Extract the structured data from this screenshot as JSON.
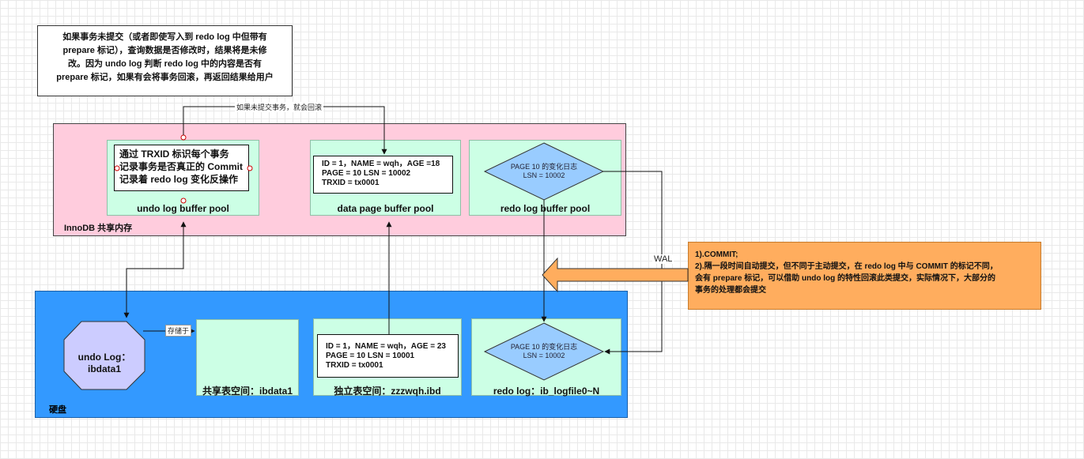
{
  "top_note": "如果事务未提交（或者即使写入到 redo log 中但带有\nprepare 标记），查询数据是否修改时，结果将是未修\n改。因为 undo log 判断 redo log 中的内容是否有\nprepare 标记，如果有会将事务回滚，再返回结果给用户",
  "rollback_edge_label": "如果未提交事务，就会回滚",
  "innodb": {
    "label": "InnoDB 共享内存",
    "undo_pool": {
      "label": "undo log buffer pool",
      "inner": "通过 TRXID 标识每个事务\n记录事务是否真正的 Commit\n记录着 redo log 变化反操作"
    },
    "data_pool": {
      "label": "data page buffer pool",
      "record": "ID = 1，NAME = wqh，AGE =18\nPAGE = 10 LSN = 10002\nTRXID = tx0001"
    },
    "redo_pool": {
      "label": "redo log buffer pool",
      "diamond": "PAGE 10 的变化日志\nLSN = 10002"
    }
  },
  "disk": {
    "label": "硬盘",
    "undo_file": {
      "label": "undo Log：ibdata1"
    },
    "store_edge_label": "存储于",
    "shared_space": {
      "label": "共享表空间：ibdata1"
    },
    "independent_space": {
      "label": "独立表空间：zzzwqh.ibd",
      "record": "ID = 1，NAME = wqh，AGE = 23\nPAGE = 10 LSN = 10001\nTRXID = tx0001"
    },
    "redo_file": {
      "label": "redo log：ib_logfile0~N",
      "diamond": "PAGE 10 的变化日志\nLSN = 10002"
    }
  },
  "wal_label": "WAL",
  "commit_note": "1).COMMIT;\n2).隔一段时间自动提交，但不同于主动提交，在 redo log 中与 COMMIT 的标记不同，\n会有 prepare 标记，可以借助 undo log 的特性回滚此类提交，实际情况下，大部分的\n事务的处理都会提交",
  "colors": {
    "innodb_fill": "#ffccdd",
    "disk_fill": "#3399ff",
    "pool_fill": "#ccffe5",
    "diamond_fill": "#99ccff",
    "octagon_fill": "#ccccff",
    "note_fill": "#ffad5e"
  }
}
